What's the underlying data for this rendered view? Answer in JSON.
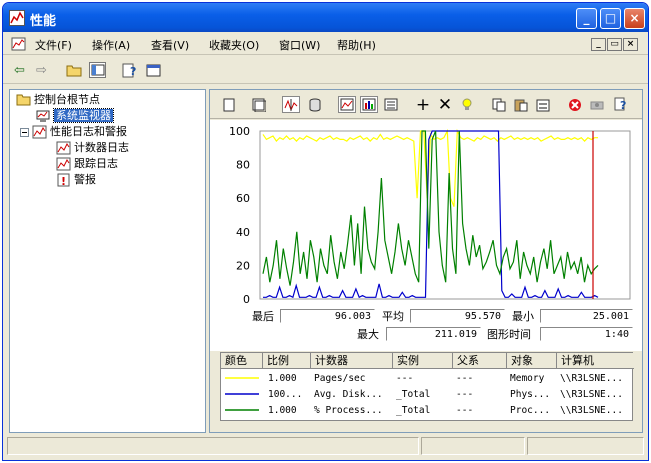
{
  "window": {
    "title": "性能"
  },
  "menu": [
    "文件(F)",
    "操作(A)",
    "查看(V)",
    "收藏夹(O)",
    "窗口(W)",
    "帮助(H)"
  ],
  "tree": {
    "root": "控制台根节点",
    "monitor": "系统监视器",
    "logs": "性能日志和警报",
    "counter_log": "计数器日志",
    "trace_log": "跟踪日志",
    "alerts": "警报"
  },
  "stats": {
    "last_label": "最后",
    "last": "96.003",
    "avg_label": "平均",
    "avg": "95.570",
    "min_label": "最小",
    "min": "25.001",
    "max_label": "最大",
    "max": "211.019",
    "time_label": "图形时间",
    "time": "1:40"
  },
  "legend": {
    "headers": [
      "颜色",
      "比例",
      "计数器",
      "实例",
      "父系",
      "对象",
      "计算机"
    ],
    "rows": [
      {
        "color": "#ffff00",
        "scale": "1.000",
        "counter": "Pages/sec",
        "instance": "---",
        "parent": "---",
        "object": "Memory",
        "computer": "\\\\R3LSNE..."
      },
      {
        "color": "#0000cc",
        "scale": "100...",
        "counter": "Avg. Disk...",
        "instance": "_Total",
        "parent": "---",
        "object": "Phys...",
        "computer": "\\\\R3LSNE..."
      },
      {
        "color": "#008000",
        "scale": "1.000",
        "counter": "% Process...",
        "instance": "_Total",
        "parent": "---",
        "object": "Proc...",
        "computer": "\\\\R3LSNE..."
      }
    ]
  },
  "chart_data": {
    "type": "line",
    "ylim": [
      0,
      100
    ],
    "yticks": [
      "100",
      "80",
      "60",
      "40",
      "20",
      "0"
    ],
    "grid": false,
    "series": [
      {
        "name": "Pages/sec",
        "color": "#ffff00",
        "values": [
          98,
          95,
          96,
          97,
          94,
          96,
          95,
          97,
          95,
          96,
          94,
          96,
          95,
          97,
          96,
          95,
          94,
          96,
          95,
          96,
          97,
          95,
          96,
          95,
          95,
          94,
          96,
          95,
          96,
          97,
          95,
          96,
          94,
          96,
          95,
          98,
          95,
          96,
          95,
          96,
          97,
          96,
          95,
          96,
          95,
          94,
          60,
          100,
          100,
          60,
          98,
          95,
          96,
          95,
          96,
          100,
          60,
          55,
          100,
          96,
          95,
          96,
          95,
          94,
          96,
          95,
          97,
          96,
          95,
          96,
          94,
          96,
          95,
          96,
          97,
          95,
          96,
          95,
          96,
          95,
          96,
          95,
          96,
          94,
          95,
          96,
          97,
          95,
          96,
          95,
          95,
          96,
          95,
          96,
          95,
          96,
          94,
          96,
          95,
          96,
          96
        ]
      },
      {
        "name": "Avg. Disk...",
        "color": "#0000cc",
        "values": [
          1,
          1,
          2,
          1,
          1,
          7,
          1,
          1,
          2,
          1,
          8,
          1,
          1,
          1,
          2,
          1,
          1,
          7,
          1,
          1,
          2,
          1,
          1,
          1,
          5,
          1,
          1,
          1,
          6,
          1,
          2,
          1,
          1,
          1,
          1,
          9,
          1,
          1,
          2,
          1,
          1,
          1,
          4,
          1,
          1,
          2,
          1,
          1,
          1,
          1,
          95,
          100,
          100,
          100,
          100,
          100,
          100,
          100,
          100,
          100,
          100,
          100,
          100,
          100,
          100,
          100,
          100,
          100,
          100,
          100,
          100,
          100,
          5,
          1,
          1,
          3,
          1,
          1,
          1,
          7,
          1,
          1,
          2,
          1,
          1,
          5,
          1,
          1,
          1,
          6,
          1,
          1,
          2,
          1,
          1,
          1,
          4,
          1,
          1,
          1,
          2,
          1
        ]
      },
      {
        "name": "% Process...",
        "color": "#008000",
        "values": [
          15,
          25,
          10,
          20,
          35,
          12,
          30,
          18,
          8,
          22,
          40,
          15,
          28,
          12,
          35,
          25,
          10,
          30,
          20,
          15,
          38,
          22,
          12,
          28,
          18,
          33,
          50,
          20,
          45,
          15,
          55,
          30,
          22,
          18,
          40,
          72,
          35,
          25,
          15,
          28,
          45,
          30,
          20,
          35,
          25,
          15,
          10,
          100,
          100,
          30,
          95,
          100,
          40,
          20,
          10,
          75,
          30,
          15,
          100,
          45,
          30,
          20,
          38,
          25,
          32,
          18,
          22,
          28,
          35,
          20,
          15,
          25,
          30,
          18,
          22,
          35,
          12,
          28,
          20,
          15,
          25,
          10,
          22,
          30,
          18,
          35,
          15,
          20,
          25,
          12,
          28,
          18,
          22,
          15,
          25,
          10,
          20,
          15,
          18,
          20
        ]
      }
    ]
  }
}
